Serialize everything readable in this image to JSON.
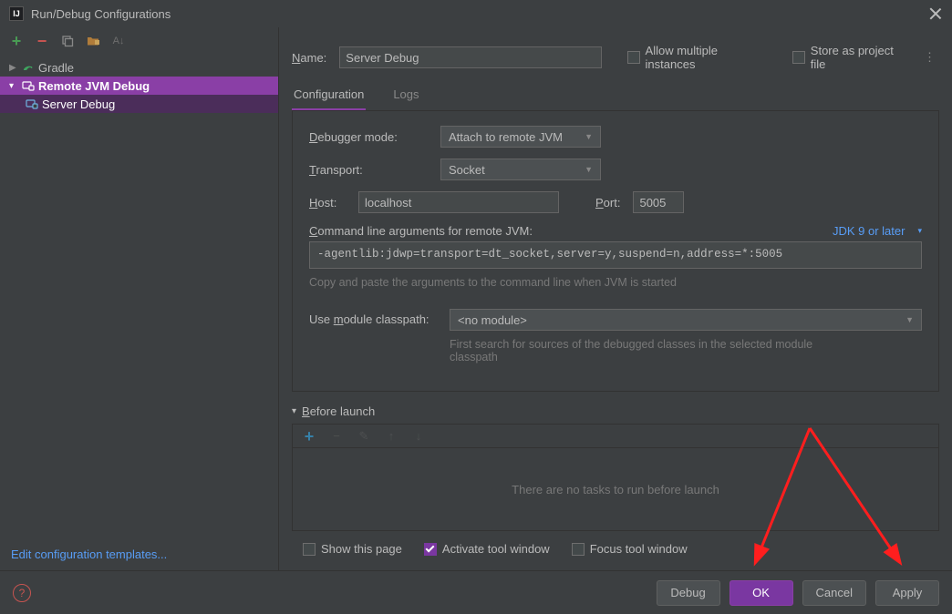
{
  "window": {
    "title": "Run/Debug Configurations"
  },
  "tree": {
    "gradle": "Gradle",
    "remote": "Remote JVM Debug",
    "serverDebug": "Server Debug"
  },
  "editTemplates": "Edit configuration templates...",
  "nameLabel": "Name:",
  "nameValue": "Server Debug",
  "allowMultiple": "Allow multiple instances",
  "storeAsFile": "Store as project file",
  "tabs": {
    "configuration": "Configuration",
    "logs": "Logs"
  },
  "form": {
    "debuggerModeLabel": "Debugger mode:",
    "debuggerModeValue": "Attach to remote JVM",
    "transportLabel": "Transport:",
    "transportValue": "Socket",
    "hostLabel": "Host:",
    "hostValue": "localhost",
    "portLabel": "Port:",
    "portValue": "5005",
    "cmdLineLabel": "Command line arguments for remote JVM:",
    "jdkLink": "JDK 9 or later",
    "cmdLineValue": "-agentlib:jdwp=transport=dt_socket,server=y,suspend=n,address=*:5005",
    "cmdHint": "Copy and paste the arguments to the command line when JVM is started",
    "moduleLabel": "Use module classpath:",
    "moduleValue": "<no module>",
    "moduleHint": "First search for sources of the debugged classes in the selected module classpath"
  },
  "beforeLaunch": {
    "header": "Before launch",
    "empty": "There are no tasks to run before launch"
  },
  "bottomChecks": {
    "showPage": "Show this page",
    "activate": "Activate tool window",
    "focus": "Focus tool window"
  },
  "buttons": {
    "debug": "Debug",
    "ok": "OK",
    "cancel": "Cancel",
    "apply": "Apply"
  }
}
